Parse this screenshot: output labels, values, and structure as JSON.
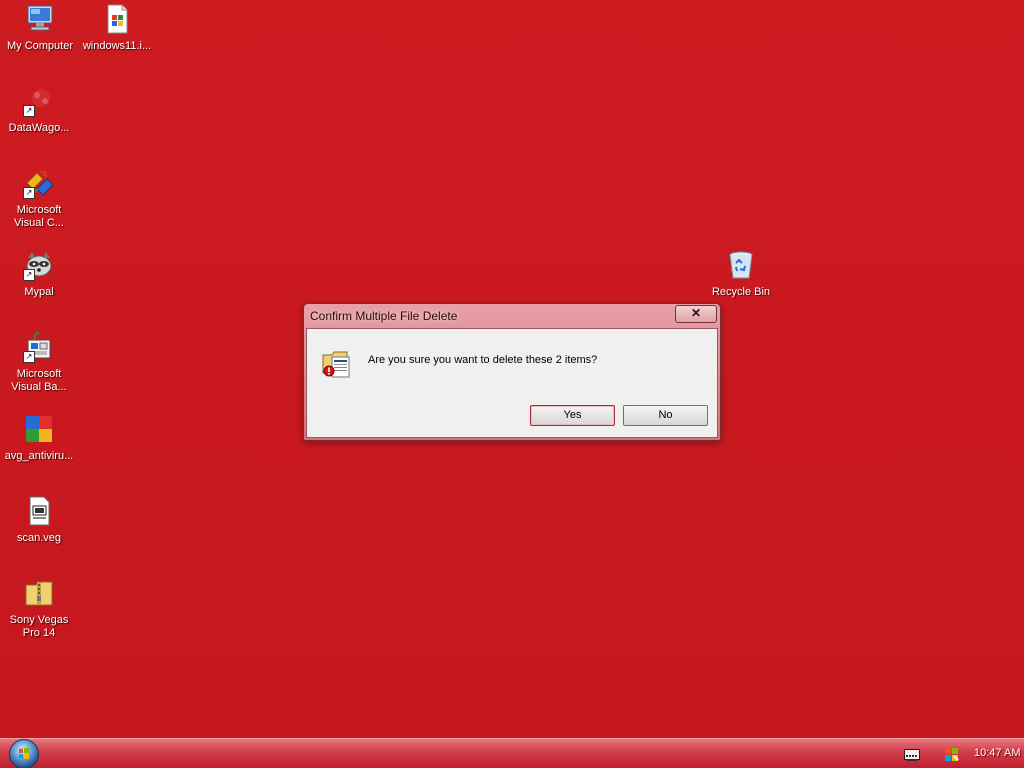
{
  "desktop": {
    "background_color": "#c8191e",
    "icons": [
      {
        "id": "my-computer",
        "label": "My Computer",
        "icon": "computer-icon"
      },
      {
        "id": "windows11",
        "label": "windows11.i...",
        "icon": "document-icon"
      },
      {
        "id": "datawago",
        "label": "DataWago...",
        "icon": "app-shortcut-icon"
      },
      {
        "id": "ms-visual-c",
        "label": "Microsoft\nVisual C...",
        "icon": "visual-c-icon"
      },
      {
        "id": "mypal",
        "label": "Mypal",
        "icon": "raccoon-icon"
      },
      {
        "id": "ms-visual-basic",
        "label": "Microsoft\nVisual Ba...",
        "icon": "visual-basic-icon"
      },
      {
        "id": "avg",
        "label": "avg_antiviru...",
        "icon": "avg-icon"
      },
      {
        "id": "scan-veg",
        "label": "scan.veg",
        "icon": "veg-file-icon"
      },
      {
        "id": "sony-vegas",
        "label": "Sony Vegas\nPro 14",
        "icon": "zip-folder-icon"
      },
      {
        "id": "recycle-bin",
        "label": "Recycle Bin",
        "icon": "recycle-bin-icon"
      }
    ]
  },
  "dialog": {
    "title": "Confirm Multiple File Delete",
    "close_label": "✕",
    "message": "Are you sure you want to delete these 2 items?",
    "yes_label": "Yes",
    "no_label": "No",
    "icon": "delete-files-warning-icon"
  },
  "taskbar": {
    "start_icon": "windows-start-orb",
    "tray_icons": [
      "keyboard-icon",
      "windows-flag-icon"
    ],
    "clock": "10:47 AM"
  }
}
